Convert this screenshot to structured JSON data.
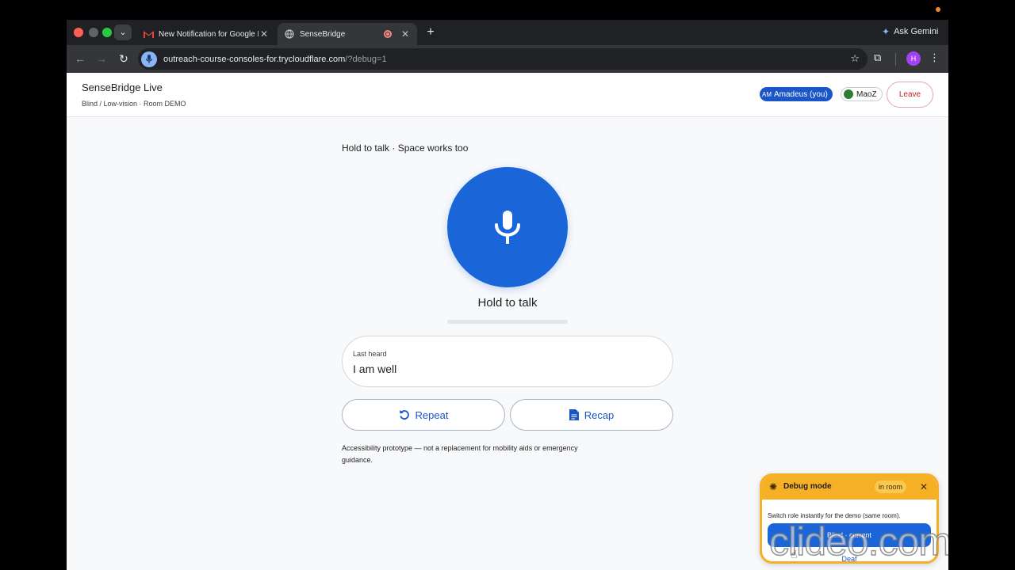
{
  "browser": {
    "tabs": [
      {
        "title": "New Notification for Google D",
        "close": "✕"
      },
      {
        "title": "SenseBridge",
        "close": "✕"
      }
    ],
    "new_tab": "+",
    "ask_gemini": "Ask Gemini",
    "url": {
      "main": "outreach-course-consoles-for.trycloudflare.com",
      "path": "/?debug=1"
    },
    "profile_initial": "H"
  },
  "header": {
    "brand": "SenseBridge Live",
    "subtitle": "Blind / Low-vision · Room DEMO",
    "participants": [
      {
        "initials": "AM",
        "name": "Amadeus (you)"
      },
      {
        "name": "MaoZ"
      }
    ],
    "leave_label": "Leave"
  },
  "main": {
    "hint": "Hold to talk · Space works too",
    "hold_label": "Hold to talk",
    "last_heard_label": "Last heard",
    "last_heard_text": "I am well",
    "repeat_label": "Repeat",
    "recap_label": "Recap",
    "disclaimer": "Accessibility prototype — not a replacement for mobility aids or emergency guidance."
  },
  "debug": {
    "title": "Debug mode",
    "status": "in room",
    "close": "✕",
    "description": "Switch role instantly for the demo (same room).",
    "role_blind": "Blind · current",
    "role_deaf": "Deaf"
  },
  "watermark": "clideo.com",
  "colors": {
    "accent": "#1a66d9",
    "debug": "#f6b026",
    "leave": "#c5221f"
  }
}
